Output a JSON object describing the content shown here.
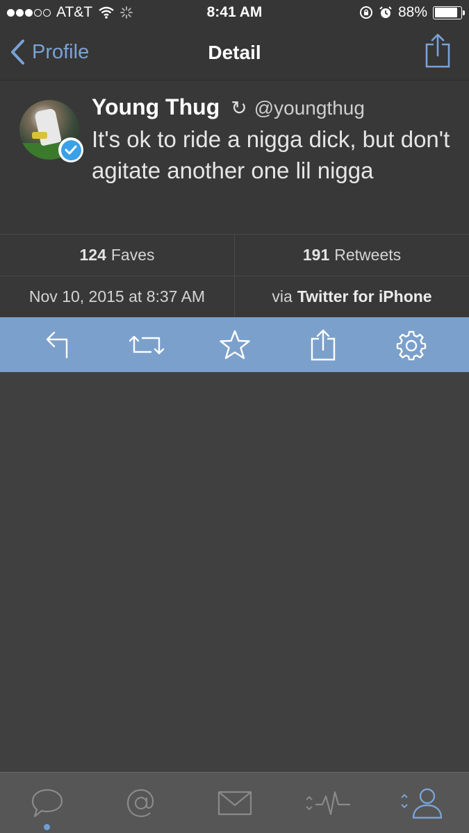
{
  "status_bar": {
    "carrier": "AT&T",
    "time": "8:41 AM",
    "battery_percent": "88%",
    "battery_level": 0.88,
    "signal_bars_filled": 3,
    "signal_bars_total": 5
  },
  "nav": {
    "back_label": "Profile",
    "title": "Detail"
  },
  "tweet": {
    "display_name": "Young Thug",
    "follow_glyph": "↻",
    "handle": "@youngthug",
    "text": "It's ok to ride a nigga dick, but don't agitate another one lil nigga",
    "verified": true
  },
  "stats": {
    "faves_count": "124",
    "faves_label": "Faves",
    "retweets_count": "191",
    "retweets_label": "Retweets"
  },
  "meta": {
    "timestamp": "Nov 10, 2015 at 8:37 AM",
    "via_prefix": "via",
    "via_app": "Twitter for iPhone"
  },
  "actions": [
    "reply-icon",
    "retweet-icon",
    "star-icon",
    "share-icon",
    "gear-icon"
  ],
  "tabs": [
    "chat-bubble-icon",
    "at-sign-icon",
    "envelope-icon",
    "activity-icon",
    "profile-icon"
  ],
  "colors": {
    "accent": "#7aa3d6",
    "action_bar": "#7ba0cb",
    "background": "#404040",
    "verified": "#3aa0e8"
  }
}
